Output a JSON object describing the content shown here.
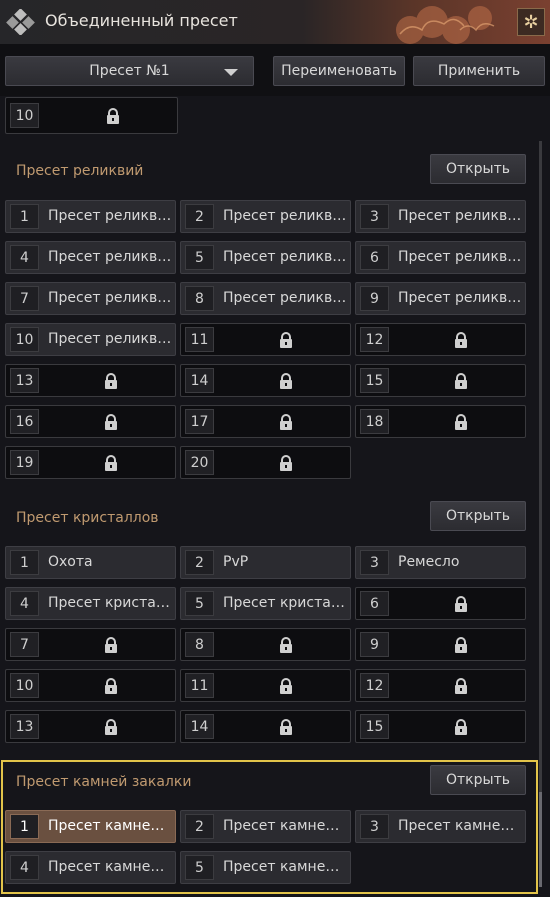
{
  "window": {
    "title": "Объединенный пресет"
  },
  "toolbar": {
    "preset_selected": "Пресет №1",
    "rename_label": "Переименовать",
    "apply_label": "Применить"
  },
  "top_partial": {
    "num": "10"
  },
  "relics": {
    "title": "Пресет реликвий",
    "open_label": "Открыть",
    "slots": [
      {
        "num": "1",
        "label": "Пресет реликви..."
      },
      {
        "num": "2",
        "label": "Пресет реликви..."
      },
      {
        "num": "3",
        "label": "Пресет реликви..."
      },
      {
        "num": "4",
        "label": "Пресет реликви..."
      },
      {
        "num": "5",
        "label": "Пресет реликви..."
      },
      {
        "num": "6",
        "label": "Пресет реликви..."
      },
      {
        "num": "7",
        "label": "Пресет реликви..."
      },
      {
        "num": "8",
        "label": "Пресет реликви..."
      },
      {
        "num": "9",
        "label": "Пресет реликви..."
      },
      {
        "num": "10",
        "label": "Пресет реликви..."
      },
      {
        "num": "11"
      },
      {
        "num": "12"
      },
      {
        "num": "13"
      },
      {
        "num": "14"
      },
      {
        "num": "15"
      },
      {
        "num": "16"
      },
      {
        "num": "17"
      },
      {
        "num": "18"
      },
      {
        "num": "19"
      },
      {
        "num": "20"
      }
    ]
  },
  "crystals": {
    "title": "Пресет кристаллов",
    "open_label": "Открыть",
    "slots": [
      {
        "num": "1",
        "label": "Охота"
      },
      {
        "num": "2",
        "label": "PvP"
      },
      {
        "num": "3",
        "label": "Ремесло"
      },
      {
        "num": "4",
        "label": "Пресет кристал..."
      },
      {
        "num": "5",
        "label": "Пресет кристал..."
      },
      {
        "num": "6"
      },
      {
        "num": "7"
      },
      {
        "num": "8"
      },
      {
        "num": "9"
      },
      {
        "num": "10"
      },
      {
        "num": "11"
      },
      {
        "num": "12"
      },
      {
        "num": "13"
      },
      {
        "num": "14"
      },
      {
        "num": "15"
      }
    ]
  },
  "tempering": {
    "title": "Пресет камней закалки",
    "open_label": "Открыть",
    "selected_slot": "1",
    "slots": [
      {
        "num": "1",
        "label": "Пресет камней ..."
      },
      {
        "num": "2",
        "label": "Пресет камней ..."
      },
      {
        "num": "3",
        "label": "Пресет камней ..."
      },
      {
        "num": "4",
        "label": "Пресет камней ..."
      },
      {
        "num": "5",
        "label": "Пресет камней ..."
      }
    ]
  },
  "icons": {
    "app": "diamond-cluster-icon",
    "corner": "star-icon",
    "dropdown": "caret-down-icon",
    "locked_slot": "lock-icon"
  },
  "colors": {
    "section_title": "#c09a70",
    "highlight_border": "#e2c44a",
    "selected_slot": "#6a5040"
  }
}
